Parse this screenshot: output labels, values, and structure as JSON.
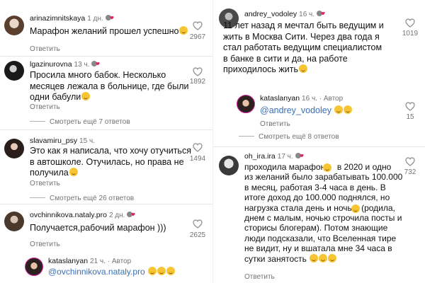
{
  "left": [
    {
      "username": "arinazimnitskaya",
      "time": "1 дн.",
      "text": "Марафон желаний прошел успешно",
      "emoji": true,
      "likes": "2967",
      "reply": "Ответить"
    },
    {
      "username": "lgazinurovna",
      "time": "13 ч.",
      "text": "Просила много бабок. Несколько\nмесяцев лежала в больнице, где были\nодни бабули",
      "emoji": true,
      "likes": "1892",
      "reply": "Ответить",
      "more": "Смотреть ещё 7 ответов"
    },
    {
      "username": "slavamiru_psy",
      "time": "15 ч.",
      "text": "Это как я написала, что хочу отучиться\nв автошколе. Отучилась, но права не\nполучила",
      "emoji": true,
      "likes": "1494",
      "reply": "Ответить",
      "more": "Смотреть ещё 26 ответов"
    },
    {
      "username": "ovchinnikova.nataly.pro",
      "time": "2 дн.",
      "text": "Получается,рабочий марафон )))",
      "emoji": false,
      "likes": "2625",
      "reply": "Ответить"
    },
    {
      "username": "kataslanyan",
      "time": "21 ч.",
      "author": "Автор",
      "mention": "@ovchinnikova.nataly.pro",
      "emoji_count": 3
    }
  ],
  "right": [
    {
      "username": "andrey_vodoley",
      "time": "16 ч.",
      "text": "11 лет назад я мечтал быть ведущим и\nжить в Москва Сити. Через два года я\nстал работать ведущим специалистом\nв банке в сити и да, на работе\nприходилось жить",
      "emoji": true,
      "likes": "1019"
    },
    {
      "username": "kataslanyan",
      "time": "16 ч.",
      "author": "Автор",
      "mention": "@andrey_vodoley",
      "emoji_count": 2,
      "likes": "15",
      "reply": "Ответить",
      "more": "Смотреть ещё 8 ответов"
    },
    {
      "username": "oh_ira.ira",
      "time": "17 ч.",
      "text": "проходила марафон     в 2020 и одно\nиз желаний было зарабатывать 100.000\nв месяц, работая 3-4 часа в день. В\nитоге доход до 100.000 поднялся, но\nнагрузка стала день и ночь    (родила,\nднем с малым, ночью строчила посты и\nсторисы блогерам). Потом знающие\nлюди подсказали, что Вселенная тире\nне видит, ну и вшатала мне 34 часа в\nсутки занятость",
      "emoji_count": 3,
      "likes": "732",
      "reply": "Ответить"
    }
  ],
  "colors": {
    "accent": "#d6249f",
    "muted": "#737373",
    "link": "#3b6fb6",
    "heart": "#8e8e8e"
  }
}
